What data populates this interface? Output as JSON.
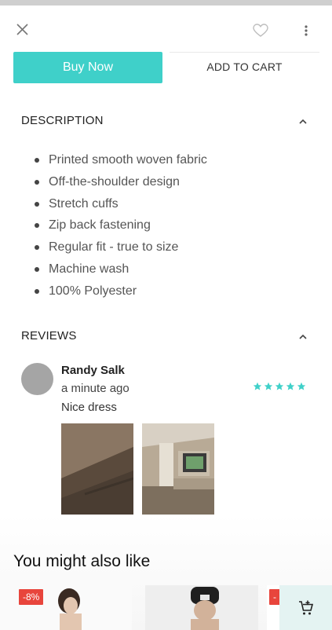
{
  "header": {
    "close_icon": "close-icon",
    "wishlist_icon": "heart-icon",
    "more_icon": "more-vert-icon"
  },
  "actions": {
    "buy_now_label": "Buy Now",
    "add_to_cart_label": "ADD TO CART",
    "accent_color": "#3fd0c9"
  },
  "description": {
    "title": "DESCRIPTION",
    "items": [
      "Printed smooth woven fabric",
      "Off-the-shoulder design",
      "Stretch cuffs",
      "Zip back fastening",
      "Regular fit - true to size",
      "Machine wash",
      "100% Polyester"
    ]
  },
  "reviews": {
    "title": "REVIEWS",
    "items": [
      {
        "name": "Randy Salk",
        "time": "a minute ago",
        "text": "Nice dress",
        "rating": 5,
        "photo_count": 2
      }
    ]
  },
  "recommendations": {
    "title": "You might also like",
    "cards": [
      {
        "badge": "-8%"
      },
      {
        "badge": ""
      },
      {
        "badge": "-"
      }
    ]
  },
  "cart_icon": "add-shopping-cart-icon"
}
